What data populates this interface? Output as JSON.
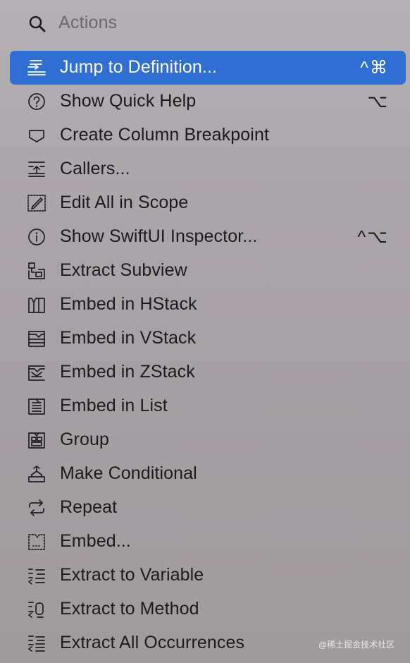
{
  "search": {
    "placeholder": "Actions",
    "icon": "search-icon"
  },
  "items": [
    {
      "label": "Jump to Definition...",
      "shortcut": "^⌘",
      "icon": "jump-to-definition-icon",
      "selected": true
    },
    {
      "label": "Show Quick Help",
      "shortcut": "⌥",
      "icon": "question-circle-icon"
    },
    {
      "label": "Create Column Breakpoint",
      "shortcut": "",
      "icon": "breakpoint-icon"
    },
    {
      "label": "Callers...",
      "shortcut": "",
      "icon": "callers-icon"
    },
    {
      "label": "Edit All in Scope",
      "shortcut": "",
      "icon": "edit-scope-icon"
    },
    {
      "label": "Show SwiftUI Inspector...",
      "shortcut": "^⌥",
      "icon": "info-circle-icon"
    },
    {
      "label": "Extract Subview",
      "shortcut": "",
      "icon": "extract-subview-icon"
    },
    {
      "label": "Embed in HStack",
      "shortcut": "",
      "icon": "hstack-icon"
    },
    {
      "label": "Embed in VStack",
      "shortcut": "",
      "icon": "vstack-icon"
    },
    {
      "label": "Embed in ZStack",
      "shortcut": "",
      "icon": "zstack-icon"
    },
    {
      "label": "Embed in List",
      "shortcut": "",
      "icon": "list-icon"
    },
    {
      "label": "Group",
      "shortcut": "",
      "icon": "group-icon"
    },
    {
      "label": "Make Conditional",
      "shortcut": "",
      "icon": "conditional-icon"
    },
    {
      "label": "Repeat",
      "shortcut": "",
      "icon": "repeat-icon"
    },
    {
      "label": "Embed...",
      "shortcut": "",
      "icon": "embed-icon"
    },
    {
      "label": "Extract to Variable",
      "shortcut": "",
      "icon": "extract-variable-icon"
    },
    {
      "label": "Extract to Method",
      "shortcut": "",
      "icon": "extract-method-icon"
    },
    {
      "label": "Extract All Occurrences",
      "shortcut": "",
      "icon": "extract-all-icon"
    }
  ],
  "watermark": "@稀土掘金技术社区",
  "colors": {
    "selection": "#2f6fd3",
    "text": "#1b1b1d",
    "placeholder": "#6c6870"
  }
}
